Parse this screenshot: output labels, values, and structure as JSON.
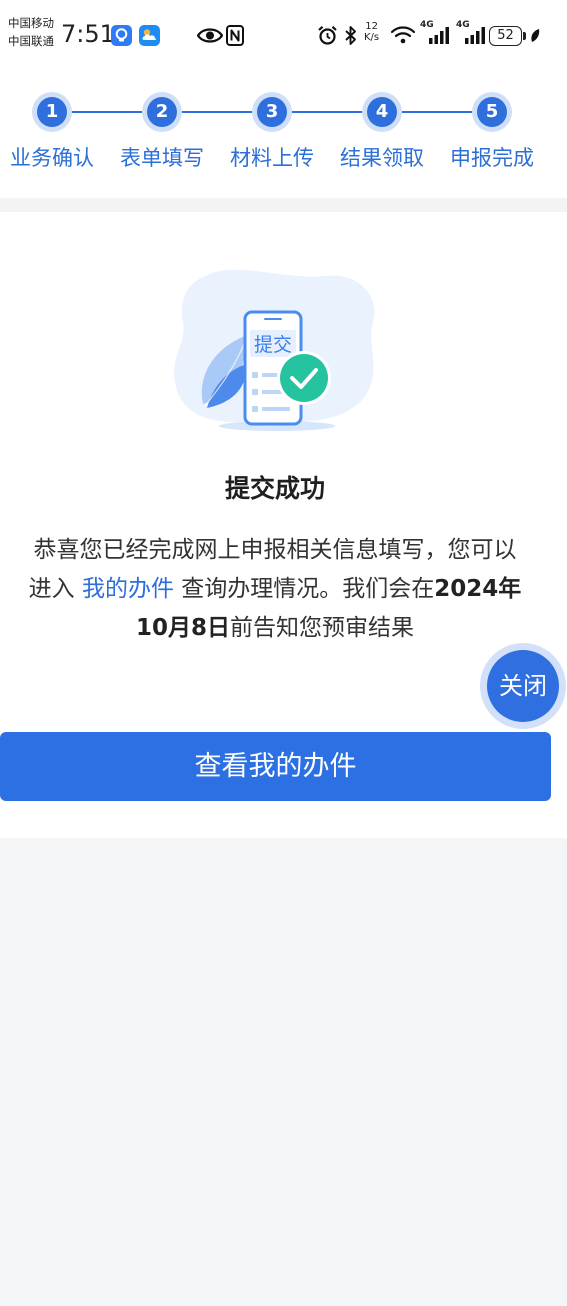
{
  "status_bar": {
    "carrier_1": "中国移动",
    "carrier_2": "中国联通",
    "time": "7:51",
    "net_speed_value": "12",
    "net_speed_unit": "K/s",
    "network_1": "4G",
    "network_2": "4G",
    "battery_level": "52",
    "icons": [
      "app-shield-icon",
      "weather-app-icon",
      "eye-icon",
      "nfc-icon",
      "alarm-icon",
      "bluetooth-icon",
      "wifi-icon",
      "signal-icon",
      "signal-icon",
      "battery-icon",
      "leaf-icon"
    ]
  },
  "stepper": {
    "steps": [
      {
        "number": "1",
        "label": "业务确认"
      },
      {
        "number": "2",
        "label": "表单填写"
      },
      {
        "number": "3",
        "label": "材料上传"
      },
      {
        "number": "4",
        "label": "结果领取"
      },
      {
        "number": "5",
        "label": "申报完成"
      }
    ]
  },
  "result": {
    "illustration_text": "提交",
    "title": "提交成功",
    "message": {
      "line1": "恭喜您已经完成网上申报相关信息填写，您可以",
      "line2_prefix": "进入 ",
      "link_text": "我的办件",
      "line2_middle": " 查询办理情况。我们会在",
      "date_year": "2024年",
      "date_day": "10月8日",
      "line3_suffix": "前告知您预审结果"
    }
  },
  "close_button": {
    "label": "关闭"
  },
  "primary_button": {
    "label": "查看我的办件"
  },
  "colors": {
    "primary": "#2f6fdd",
    "success": "#25c39f",
    "background": "#f4f5f7"
  }
}
